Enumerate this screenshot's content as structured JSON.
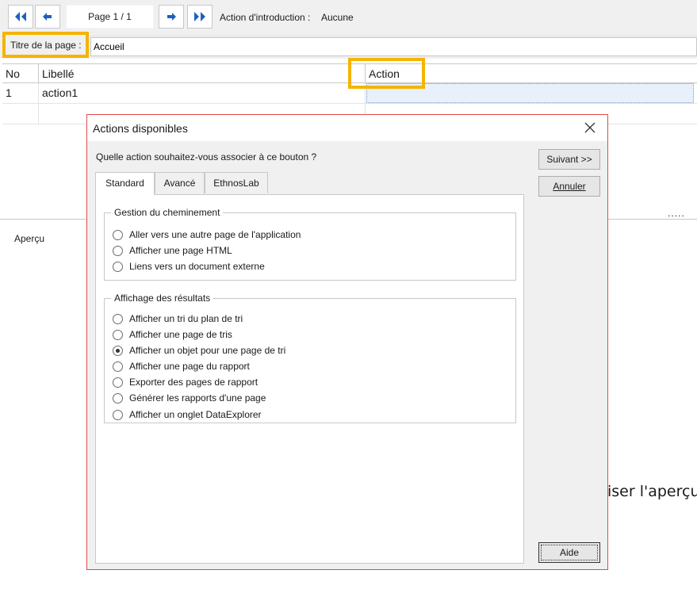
{
  "toolbar": {
    "first_icon": "double-left-arrow-icon",
    "prev_icon": "left-arrow-icon",
    "page_indicator": "Page 1 / 1",
    "next_icon": "right-arrow-icon",
    "last_icon": "double-right-arrow-icon",
    "intro_label": "Action d'introduction :",
    "intro_value": "Aucune"
  },
  "page_title": {
    "label": "Titre de la page :",
    "value": "Accueil"
  },
  "grid": {
    "headers": [
      "No",
      "Libellé",
      "Action"
    ],
    "rows": [
      {
        "no": "1",
        "libelle": "action1",
        "action": ""
      }
    ]
  },
  "background": {
    "dots": ".....",
    "apercu_label": "Aperçu",
    "partial_text": "iser l'aperçu"
  },
  "dialog": {
    "title": "Actions disponibles",
    "question": "Quelle action souhaitez-vous associer à ce bouton ?",
    "tabs": [
      "Standard",
      "Avancé",
      "EthnosLab"
    ],
    "groups": [
      {
        "title": "Gestion du cheminement",
        "options": [
          {
            "label": "Aller vers une autre page de l'application",
            "checked": false
          },
          {
            "label": "Afficher une page HTML",
            "checked": false
          },
          {
            "label": "Liens vers un document externe",
            "checked": false
          }
        ]
      },
      {
        "title": "Affichage des résultats",
        "options": [
          {
            "label": "Afficher un tri du plan de tri",
            "checked": false
          },
          {
            "label": "Afficher une page de tris",
            "checked": false
          },
          {
            "label": "Afficher un objet pour une page de tri",
            "checked": true
          },
          {
            "label": "Afficher une page du rapport",
            "checked": false
          },
          {
            "label": "Exporter des pages de rapport",
            "checked": false
          },
          {
            "label": "Générer les rapports d'une page",
            "checked": false
          },
          {
            "label": "Afficher un onglet DataExplorer",
            "checked": false
          }
        ]
      }
    ],
    "buttons": {
      "next": "Suivant >>",
      "cancel": "Annuler",
      "help": "Aide"
    }
  },
  "colors": {
    "highlight": "#f5b400",
    "dialog_border": "#e04b4b",
    "nav_arrow": "#1f5fbf"
  }
}
